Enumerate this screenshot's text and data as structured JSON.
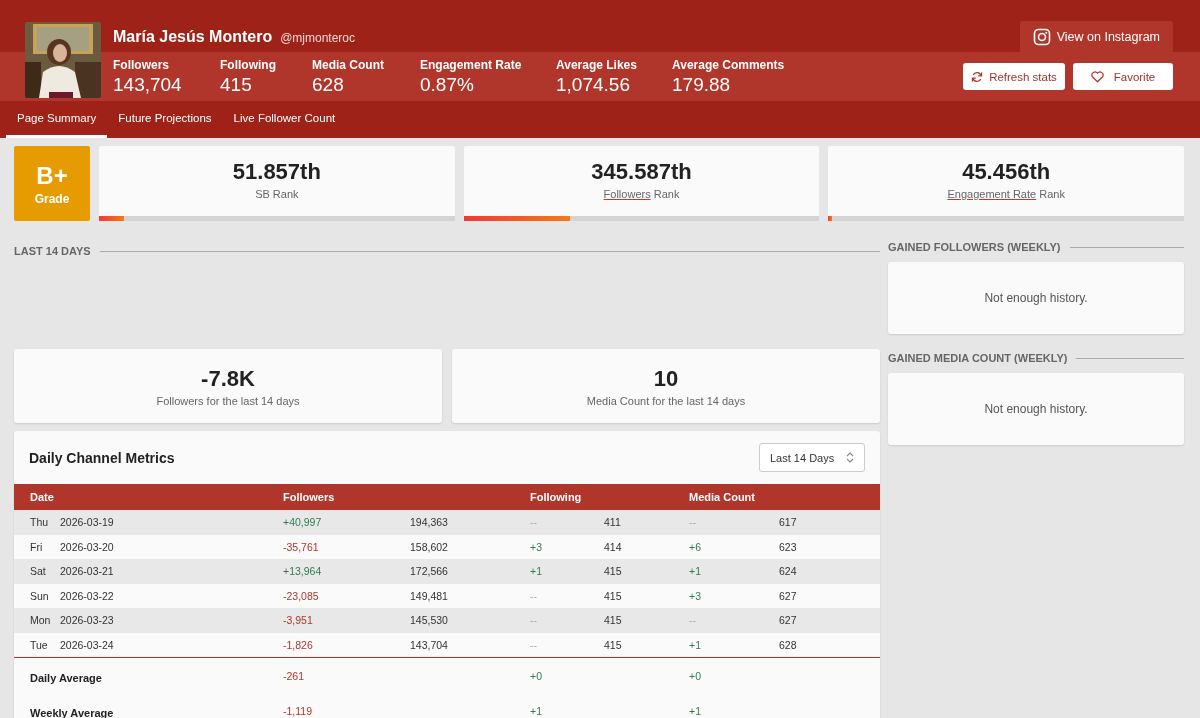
{
  "profile": {
    "name": "María Jesús Montero",
    "handle": "@mjmonteroc"
  },
  "stats": [
    {
      "label": "Followers",
      "value": "143,704"
    },
    {
      "label": "Following",
      "value": "415"
    },
    {
      "label": "Media Count",
      "value": "628"
    },
    {
      "label": "Engagement Rate",
      "value": "0.87%"
    },
    {
      "label": "Average Likes",
      "value": "1,074.56"
    },
    {
      "label": "Average Comments",
      "value": "179.88"
    }
  ],
  "instagram_link": "View on Instagram",
  "buttons": [
    {
      "kind": "refresh",
      "label": "Refresh stats"
    },
    {
      "kind": "favorite",
      "label": "Favorite"
    }
  ],
  "tabs": [
    {
      "label": "Page Summary",
      "selected": true
    },
    {
      "label": "Future Projections",
      "selected": false
    },
    {
      "label": "Live Follower Count",
      "selected": false
    }
  ],
  "grade": {
    "value": "B+",
    "label": "Grade"
  },
  "ranks": [
    {
      "value": "51.857th",
      "label": "SB Rank",
      "level": 0.07
    },
    {
      "value": "345.587th",
      "link": "Followers",
      "label": "Rank",
      "level": 0.3
    },
    {
      "value": "45.456th",
      "link": "Engagement Rate",
      "label": "Rank",
      "level": 0.01
    }
  ],
  "last14": {
    "title": "LAST 14 DAYS",
    "cards": [
      {
        "value": "-7.8K",
        "label": "Followers for the last 14 days"
      },
      {
        "value": "10",
        "label": "Media Count for the last 14 days"
      }
    ]
  },
  "side": [
    {
      "title": "GAINED FOLLOWERS (WEEKLY)",
      "message": "Not enough history."
    },
    {
      "title": "GAINED MEDIA COUNT (WEEKLY)",
      "message": "Not enough history."
    }
  ],
  "metrics": {
    "title": "Daily Channel Metrics",
    "range": "Last 14 Days",
    "columns": [
      "Date",
      "Followers",
      "Following",
      "Media Count"
    ],
    "rows": [
      {
        "cells": [
          {
            "day": "Thu",
            "date": "2026-03-19"
          },
          {
            "change": "+40,997",
            "kind": "up",
            "total": "194,363"
          },
          {
            "change": "--",
            "kind": "none",
            "total": "411"
          },
          {
            "change": "--",
            "kind": "none",
            "total": "617"
          }
        ]
      },
      {
        "cells": [
          {
            "day": "Fri",
            "date": "2026-03-20"
          },
          {
            "change": "-35,761",
            "kind": "down",
            "total": "158,602"
          },
          {
            "change": "+3",
            "kind": "up",
            "total": "414"
          },
          {
            "change": "+6",
            "kind": "up",
            "total": "623"
          }
        ]
      },
      {
        "cells": [
          {
            "day": "Sat",
            "date": "2026-03-21"
          },
          {
            "change": "+13,964",
            "kind": "up",
            "total": "172,566"
          },
          {
            "change": "+1",
            "kind": "up",
            "total": "415"
          },
          {
            "change": "+1",
            "kind": "up",
            "total": "624"
          }
        ]
      },
      {
        "cells": [
          {
            "day": "Sun",
            "date": "2026-03-22"
          },
          {
            "change": "-23,085",
            "kind": "down",
            "total": "149,481"
          },
          {
            "change": "--",
            "kind": "none",
            "total": "415"
          },
          {
            "change": "+3",
            "kind": "up",
            "total": "627"
          }
        ]
      },
      {
        "cells": [
          {
            "day": "Mon",
            "date": "2026-03-23"
          },
          {
            "change": "-3,951",
            "kind": "down",
            "total": "145,530"
          },
          {
            "change": "--",
            "kind": "none",
            "total": "415"
          },
          {
            "change": "--",
            "kind": "none",
            "total": "627"
          }
        ]
      },
      {
        "cells": [
          {
            "day": "Tue",
            "date": "2026-03-24"
          },
          {
            "change": "-1,826",
            "kind": "down",
            "total": "143,704"
          },
          {
            "change": "--",
            "kind": "none",
            "total": "415"
          },
          {
            "change": "+1",
            "kind": "up",
            "total": "628"
          }
        ]
      }
    ],
    "summary": [
      {
        "cells": [
          {
            "label": "Daily Average"
          },
          {
            "change": "-261",
            "kind": "down"
          },
          {
            "change": "+0",
            "kind": "up"
          },
          {
            "change": "+0",
            "kind": "up"
          }
        ]
      },
      {
        "cells": [
          {
            "label": "Weekly Average"
          },
          {
            "change": "-1,119",
            "kind": "down"
          },
          {
            "change": "+1",
            "kind": "up"
          },
          {
            "change": "+1",
            "kind": "up"
          }
        ]
      }
    ]
  }
}
